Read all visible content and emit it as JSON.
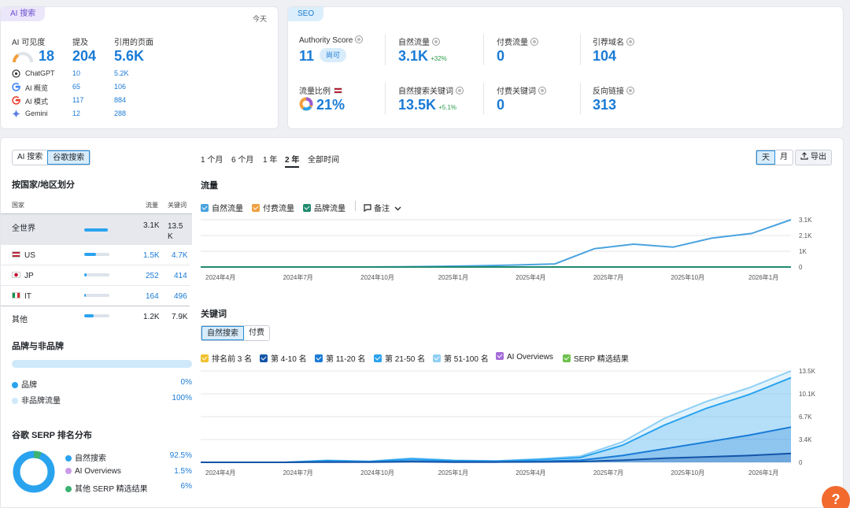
{
  "ai": {
    "tag": "AI 搜索",
    "today": "今天",
    "h_visibility": "AI 可见度",
    "h_mentions": "提及",
    "h_cited": "引用的页面",
    "visibility": "18",
    "mentions": "204",
    "cited": "5.6K",
    "rows": [
      {
        "name": "ChatGPT",
        "mentions": "10",
        "cited": "5.2K"
      },
      {
        "name": "AI 概览",
        "mentions": "65",
        "cited": "106"
      },
      {
        "name": "AI 模式",
        "mentions": "117",
        "cited": "884"
      },
      {
        "name": "Gemini",
        "mentions": "12",
        "cited": "288"
      }
    ]
  },
  "seo": {
    "tag": "SEO",
    "authority_label": "Authority Score",
    "authority_value": "11",
    "authority_badge": "尚可",
    "organic_label": "自然流量",
    "organic_value": "3.1K",
    "organic_delta": "+32%",
    "paid_label": "付费流量",
    "paid_value": "0",
    "refdomains_label": "引荐域名",
    "refdomains_value": "104",
    "share_label": "流量比例",
    "share_value": "21%",
    "okw_label": "自然搜索关键词",
    "okw_value": "13.5K",
    "okw_delta": "+5.1%",
    "pkw_label": "付费关键词",
    "pkw_value": "0",
    "backlinks_label": "反向链接",
    "backlinks_value": "313"
  },
  "toggle": {
    "ai": "AI 搜索",
    "google": "谷歌搜索"
  },
  "country": {
    "title": "按国家/地区划分",
    "h_country": "国家",
    "h_traffic": "流量",
    "h_keywords": "关键词",
    "rows": [
      {
        "name": "全世界",
        "traffic": "3.1K",
        "keywords": "13.5 K",
        "pct": 0.95
      },
      {
        "name": "US",
        "traffic": "1.5K",
        "keywords": "4.7K",
        "pct": 0.48
      },
      {
        "name": "JP",
        "traffic": "252",
        "keywords": "414",
        "pct": 0.08
      },
      {
        "name": "IT",
        "traffic": "164",
        "keywords": "496",
        "pct": 0.05
      },
      {
        "name": "其他",
        "traffic": "1.2K",
        "keywords": "7.9K",
        "pct": 0.38
      }
    ]
  },
  "brand": {
    "title": "品牌与非品牌",
    "brand_label": "品牌",
    "brand_value": "0%",
    "nonbrand_label": "非品牌流量",
    "nonbrand_value": "100%"
  },
  "serp": {
    "title": "谷歌 SERP 排名分布",
    "items": [
      {
        "label": "自然搜索",
        "value": "92.5%",
        "color": "#2aa3ef"
      },
      {
        "label": "AI Overviews",
        "value": "1.5%",
        "color": "#b57be0"
      },
      {
        "label": "其他 SERP 精选结果",
        "value": "6%",
        "color": "#3cb371"
      }
    ]
  },
  "periods": [
    "1 个月",
    "6 个月",
    "1 年",
    "2 年",
    "全部时间"
  ],
  "gran": {
    "day": "天",
    "month": "月"
  },
  "export_label": "导出",
  "traffic": {
    "title": "流量",
    "legend": [
      "自然流量",
      "付费流量",
      "品牌流量"
    ],
    "notes": "备注"
  },
  "keywords": {
    "title": "关键词",
    "tabs": [
      "自然搜索",
      "付费"
    ],
    "legend": [
      "排名前 3 名",
      "第 4-10 名",
      "第 11-20 名",
      "第 21-50 名",
      "第 51-100 名",
      "AI Overviews",
      "SERP 精选结果"
    ]
  },
  "colors": {
    "accent": "#1a7bd6",
    "organic": "#4aa3df",
    "paid": "#f0a040",
    "brand": "#1f8a70"
  },
  "chart_data": [
    {
      "type": "line",
      "title": "流量",
      "x": [
        "2024年4月",
        "2024年7月",
        "2024年10月",
        "2025年1月",
        "2025年4月",
        "2025年7月",
        "2025年10月",
        "2026年1月"
      ],
      "yticks": [
        "3.1K",
        "2.1K",
        "1K",
        "0"
      ],
      "ylim": [
        0,
        3100
      ],
      "series": [
        {
          "name": "自然流量",
          "values": [
            0,
            0,
            0,
            0,
            0,
            10,
            40,
            80,
            130,
            200,
            1200,
            1500,
            1300,
            1900,
            2200,
            3100
          ]
        },
        {
          "name": "品牌流量",
          "values": [
            0,
            0,
            0,
            0,
            0,
            0,
            0,
            0,
            0,
            0,
            0,
            0,
            0,
            0,
            0,
            0
          ]
        }
      ]
    },
    {
      "type": "area",
      "title": "关键词",
      "x": [
        "2024年4月",
        "2024年7月",
        "2024年10月",
        "2025年1月",
        "2025年4月",
        "2025年7月",
        "2025年10月",
        "2026年1月"
      ],
      "yticks": [
        "13.5K",
        "10.1K",
        "6.7K",
        "3.4K",
        "0"
      ],
      "ylim": [
        0,
        13500
      ],
      "series": [
        {
          "name": "第 51-100 名",
          "values": [
            0,
            0,
            0,
            300,
            150,
            600,
            300,
            200,
            500,
            900,
            3000,
            6500,
            9000,
            11000,
            13500
          ]
        },
        {
          "name": "第 21-50 名",
          "values": [
            0,
            0,
            0,
            250,
            120,
            500,
            250,
            180,
            400,
            700,
            2500,
            5500,
            8000,
            10000,
            12500
          ]
        },
        {
          "name": "第 11-20 名",
          "values": [
            0,
            0,
            0,
            100,
            60,
            200,
            100,
            80,
            150,
            300,
            1000,
            2000,
            3000,
            4000,
            5200
          ]
        },
        {
          "name": "第 4-10 名",
          "values": [
            0,
            0,
            0,
            40,
            30,
            80,
            40,
            30,
            60,
            100,
            300,
            600,
            800,
            1000,
            1300
          ]
        }
      ]
    }
  ]
}
